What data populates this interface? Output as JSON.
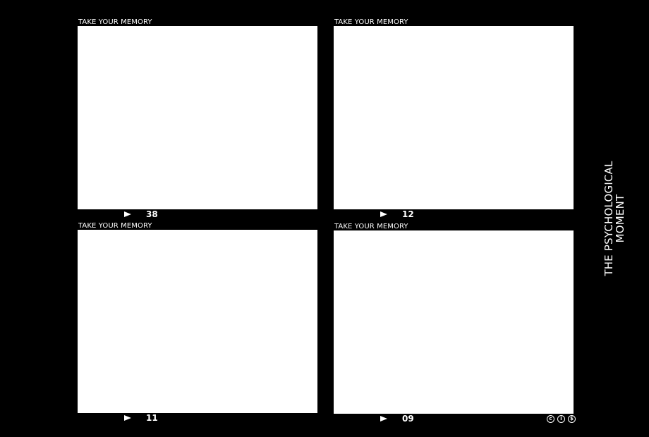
{
  "frames": [
    {
      "caption": "TAKE YOUR MEMORY",
      "number": "38",
      "play_icon": "play-triangle-icon"
    },
    {
      "caption": "TAKE YOUR MEMORY",
      "number": "12",
      "play_icon": "play-triangle-icon"
    },
    {
      "caption": "TAKE YOUR MEMORY",
      "number": "11",
      "play_icon": "play-triangle-icon"
    },
    {
      "caption": "TAKE YOUR MEMORY",
      "number": "09",
      "play_icon": "play-triangle-icon"
    }
  ],
  "side_title": {
    "line1": "THE PSYCHOLOGICAL",
    "line2": "MOMENT"
  },
  "license_icons": [
    "cc-icon",
    "by-icon",
    "nc-icon"
  ],
  "colors": {
    "background": "#000000",
    "photo": "#ffffff",
    "text": "#ffffff"
  }
}
